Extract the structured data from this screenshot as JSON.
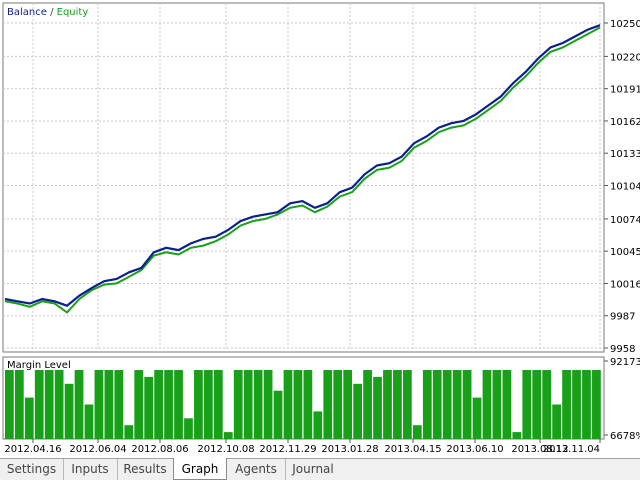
{
  "chart_data": [
    {
      "type": "line",
      "legend": {
        "balance": "Balance",
        "slash": " / ",
        "equity": "Equity"
      },
      "colors": {
        "balance": "#0b1f8f",
        "equity": "#18a018",
        "grid": "#c9c9c9"
      },
      "yticks": [
        "10250",
        "10220",
        "10191",
        "10162",
        "10133",
        "10104",
        "10074",
        "10045",
        "10016",
        "9987",
        "9958"
      ],
      "ylim": [
        9958,
        10250
      ],
      "xticks": [
        "2012.04.16",
        "2012.06.04",
        "2012.08.06",
        "2012.10.08",
        "2012.11.29",
        "2013.01.28",
        "2013.04.15",
        "2013.06.10",
        "2013.08.12",
        "2013.11.04"
      ],
      "series": [
        {
          "name": "Balance",
          "points": [
            [
              0,
              10002
            ],
            [
              2,
              10000
            ],
            [
              4,
              9998
            ],
            [
              6,
              10002
            ],
            [
              8,
              10000
            ],
            [
              10,
              9996
            ],
            [
              12,
              10005
            ],
            [
              14,
              10012
            ],
            [
              16,
              10018
            ],
            [
              18,
              10020
            ],
            [
              20,
              10026
            ],
            [
              22,
              10030
            ],
            [
              24,
              10044
            ],
            [
              26,
              10048
            ],
            [
              28,
              10046
            ],
            [
              30,
              10052
            ],
            [
              32,
              10056
            ],
            [
              34,
              10058
            ],
            [
              36,
              10064
            ],
            [
              38,
              10072
            ],
            [
              40,
              10076
            ],
            [
              42,
              10078
            ],
            [
              44,
              10080
            ],
            [
              46,
              10088
            ],
            [
              48,
              10090
            ],
            [
              50,
              10084
            ],
            [
              52,
              10088
            ],
            [
              54,
              10098
            ],
            [
              56,
              10102
            ],
            [
              58,
              10114
            ],
            [
              60,
              10122
            ],
            [
              62,
              10124
            ],
            [
              64,
              10130
            ],
            [
              66,
              10142
            ],
            [
              68,
              10148
            ],
            [
              70,
              10156
            ],
            [
              72,
              10160
            ],
            [
              74,
              10162
            ],
            [
              76,
              10168
            ],
            [
              78,
              10176
            ],
            [
              80,
              10184
            ],
            [
              82,
              10196
            ],
            [
              84,
              10206
            ],
            [
              86,
              10218
            ],
            [
              88,
              10228
            ],
            [
              90,
              10232
            ],
            [
              92,
              10238
            ],
            [
              94,
              10244
            ],
            [
              96,
              10248
            ]
          ]
        },
        {
          "name": "Equity",
          "points": [
            [
              0,
              10000
            ],
            [
              2,
              9998
            ],
            [
              4,
              9995
            ],
            [
              6,
              10000
            ],
            [
              8,
              9998
            ],
            [
              10,
              9990
            ],
            [
              12,
              10002
            ],
            [
              14,
              10010
            ],
            [
              16,
              10015
            ],
            [
              18,
              10016
            ],
            [
              20,
              10022
            ],
            [
              22,
              10028
            ],
            [
              24,
              10041
            ],
            [
              26,
              10044
            ],
            [
              28,
              10042
            ],
            [
              30,
              10048
            ],
            [
              32,
              10050
            ],
            [
              34,
              10054
            ],
            [
              36,
              10060
            ],
            [
              38,
              10068
            ],
            [
              40,
              10072
            ],
            [
              42,
              10074
            ],
            [
              44,
              10078
            ],
            [
              46,
              10084
            ],
            [
              48,
              10086
            ],
            [
              50,
              10080
            ],
            [
              52,
              10085
            ],
            [
              54,
              10094
            ],
            [
              56,
              10098
            ],
            [
              58,
              10110
            ],
            [
              60,
              10118
            ],
            [
              62,
              10120
            ],
            [
              64,
              10126
            ],
            [
              66,
              10138
            ],
            [
              68,
              10144
            ],
            [
              70,
              10152
            ],
            [
              72,
              10156
            ],
            [
              74,
              10158
            ],
            [
              76,
              10164
            ],
            [
              78,
              10172
            ],
            [
              80,
              10180
            ],
            [
              82,
              10192
            ],
            [
              84,
              10202
            ],
            [
              86,
              10214
            ],
            [
              88,
              10224
            ],
            [
              90,
              10228
            ],
            [
              92,
              10234
            ],
            [
              94,
              10240
            ],
            [
              96,
              10246
            ]
          ]
        }
      ]
    },
    {
      "type": "bar",
      "title": "Margin Level",
      "yticks": [
        "92173%",
        "6678%"
      ],
      "values": [
        1,
        1,
        0.6,
        1,
        1,
        1,
        0.8,
        1,
        0.5,
        1,
        1,
        1,
        0.2,
        1,
        0.9,
        1,
        1,
        1,
        0.3,
        1,
        1,
        1,
        0.1,
        1,
        1,
        1,
        1,
        0.7,
        1,
        1,
        1,
        0.4,
        1,
        1,
        1,
        0.8,
        1,
        0.9,
        1,
        1,
        1,
        0.2,
        1,
        1,
        1,
        1,
        1,
        0.6,
        1,
        1,
        1,
        0.1,
        1,
        1,
        1,
        0.5,
        1,
        1,
        1,
        1
      ]
    }
  ],
  "tabs": [
    {
      "label": "Settings"
    },
    {
      "label": "Inputs"
    },
    {
      "label": "Results"
    },
    {
      "label": "Graph"
    },
    {
      "label": "Agents"
    },
    {
      "label": "Journal"
    }
  ]
}
